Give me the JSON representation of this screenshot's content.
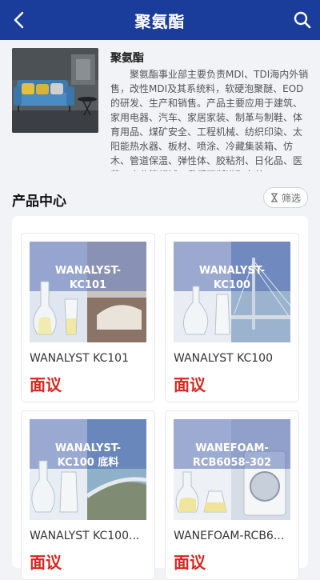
{
  "header": {
    "title": "聚氨酯"
  },
  "intro": {
    "name": "聚氨酯",
    "description": "聚氨酯事业部主要负责MDI、TDI海内外销售，改性MDI及其系统料，软硬泡聚醚、EOD的研发、生产和销售。产品主要应用于建筑、家用电器、汽车、家居家装、制革与制鞋、体育用品、煤矿安全、工程机械、纺织印染、太阳能热水器、板材、喷涂、冷藏集装箱、仿木、管道保温、弹性体、胶粘剂、日化品、医药、农业等领域。我们不断进取向着..."
  },
  "section": {
    "title": "产品中心",
    "filter_label": "筛选"
  },
  "products": [
    {
      "name": "WANALYST KC101",
      "price": "面议",
      "overlay_line1": "WANALYST-",
      "overlay_line2": "KC101"
    },
    {
      "name": "WANALYST KC100",
      "price": "面议",
      "overlay_line1": "WANALYST-",
      "overlay_line2": "KC100"
    },
    {
      "name": "WANALYST KC100...",
      "price": "面议",
      "overlay_line1": "WANALYST-",
      "overlay_line2": "KC100 底料"
    },
    {
      "name": "WANEFOAM-RCB6...",
      "price": "面议",
      "overlay_line1": "WANEFOAM-",
      "overlay_line2": "RCB6058-302"
    }
  ],
  "colors": {
    "header_bg": "#1a3d9c",
    "price": "#d7261f",
    "page_bg": "#f2f3f7"
  },
  "icons": {
    "back": "chevron-left-icon",
    "search": "search-icon",
    "filter": "hourglass-icon"
  }
}
